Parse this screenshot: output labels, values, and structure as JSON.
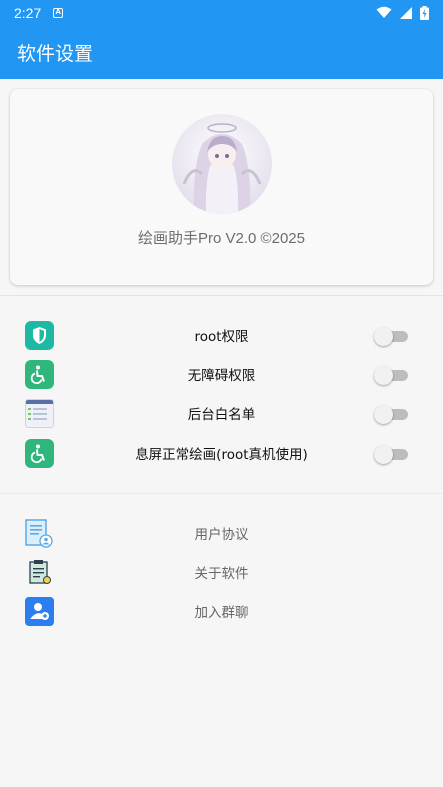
{
  "status_bar": {
    "time": "2:27",
    "notif_icon": "a-icon",
    "wifi_icon": "wifi-icon",
    "signal_icon": "signal-icon",
    "battery_icon": "battery-charging-icon"
  },
  "app_bar": {
    "title": "软件设置"
  },
  "card": {
    "version_text": "绘画助手Pro V2.0 ©2025",
    "avatar": "avatar-image"
  },
  "toggles": [
    {
      "label": "root权限",
      "icon": "shield-icon",
      "enabled": false
    },
    {
      "label": "无障碍权限",
      "icon": "accessibility-icon",
      "enabled": false
    },
    {
      "label": "后台白名单",
      "icon": "app-window-icon",
      "enabled": false
    },
    {
      "label": "息屏正常绘画(root真机使用)",
      "icon": "accessibility-icon",
      "enabled": false
    }
  ],
  "links": [
    {
      "label": "用户协议",
      "icon": "user-document-icon"
    },
    {
      "label": "关于软件",
      "icon": "clipboard-icon"
    },
    {
      "label": "加入群聊",
      "icon": "add-user-icon"
    }
  ],
  "colors": {
    "primary": "#2196f3",
    "teal": "#1fb8a3",
    "green": "#2eb67d"
  }
}
